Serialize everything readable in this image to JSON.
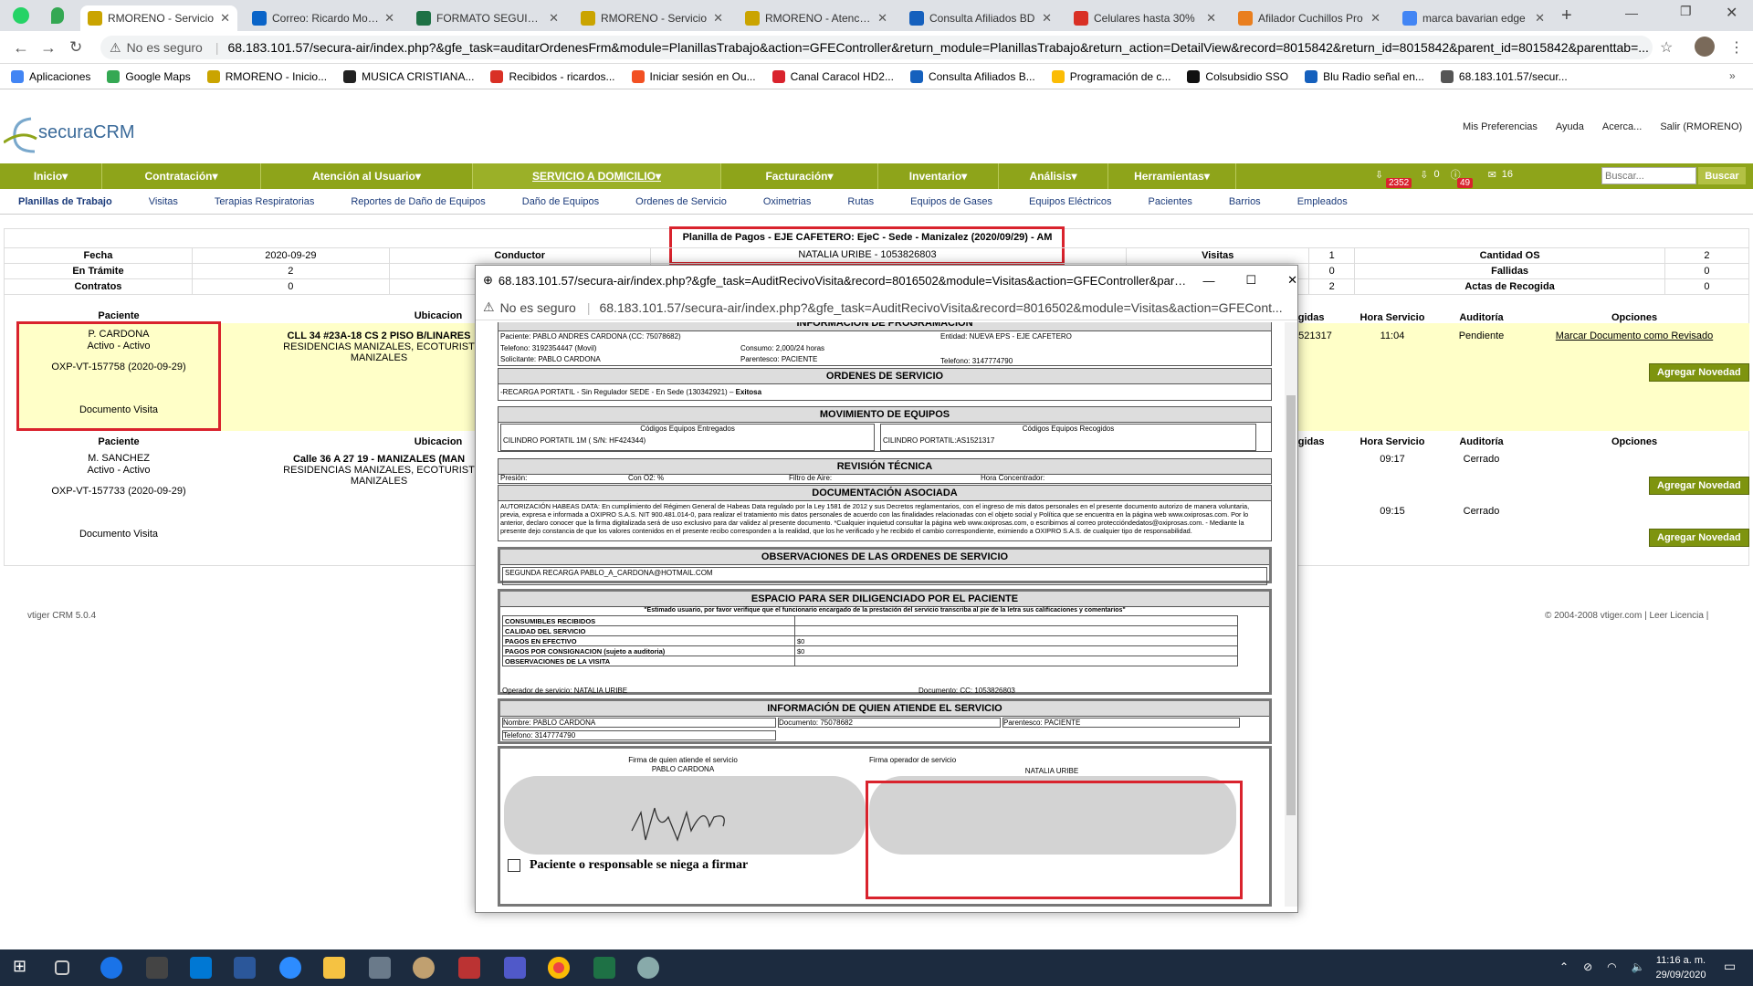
{
  "browser": {
    "tabs": [
      {
        "label": "RMORENO - Servicio",
        "active": true,
        "icon": "vtiger-icon",
        "color": "#caa400"
      },
      {
        "label": "Correo: Ricardo Moreno",
        "icon": "outlook-icon",
        "color": "#0a64c8"
      },
      {
        "label": "FORMATO SEGUIMIENTO",
        "icon": "excel-icon",
        "color": "#1e7145"
      },
      {
        "label": "RMORENO - Servicio",
        "icon": "vtiger-icon",
        "color": "#caa400"
      },
      {
        "label": "RMORENO - Atención",
        "icon": "vtiger-icon",
        "color": "#caa400"
      },
      {
        "label": "Consulta Afiliados BD",
        "icon": "triangle-icon",
        "color": "#1560bd"
      },
      {
        "label": "Celulares hasta 30%",
        "icon": "gmail-icon",
        "color": "#d93025"
      },
      {
        "label": "Afilador Cuchillos Pro",
        "icon": "product-icon",
        "color": "#e97e1e"
      },
      {
        "label": "marca bavarian edge",
        "icon": "google-icon",
        "color": "#4285f4"
      }
    ],
    "not_secure": "No es seguro",
    "url": "68.183.101.57/secura-air/index.php?&gfe_task=auditarOrdenesFrm&module=PlanillasTrabajo&action=GFEController&return_module=PlanillasTrabajo&return_action=DetailView&record=8015842&return_id=8015842&parent_id=8015842&parenttab=...",
    "bookmarks": [
      "Aplicaciones",
      "Google Maps",
      "RMORENO - Inicio...",
      "MUSICA CRISTIANA...",
      "Recibidos - ricardos...",
      "Iniciar sesión en Ou...",
      "Canal Caracol HD2...",
      "Consulta Afiliados B...",
      "Programación de c...",
      "Colsubsidio SSO",
      "Blu Radio señal en...",
      "68.183.101.57/secur..."
    ]
  },
  "app": {
    "logo": "securaCRM",
    "top_links": [
      "Mis Preferencias",
      "Ayuda",
      "Acerca...",
      "Salir (RMORENO)"
    ],
    "menu": [
      "Inicio",
      "Contratación",
      "Atención al Usuario",
      "SERVICIO A DOMICILIO",
      "Facturación",
      "Inventario",
      "Análisis",
      "Herramientas"
    ],
    "badges": {
      "a": "2352",
      "b": "0",
      "c": "49",
      "d": "16"
    },
    "search_placeholder": "Buscar...",
    "search_button": "Buscar",
    "submenu": [
      "Planillas de Trabajo",
      "Visitas",
      "Terapias Respiratorias",
      "Reportes de Daño de Equipos",
      "Daño de Equipos",
      "Ordenes de Servicio",
      "Oximetrias",
      "Rutas",
      "Equipos de Gases",
      "Equipos Eléctricos",
      "Pacientes",
      "Barrios",
      "Empleados"
    ]
  },
  "planilla": {
    "title": "Planilla de Pagos - EJE CAFETERO: EjeC - Sede - Manizalez (2020/09/29) - AM",
    "subtitle": "NATALIA URIBE - 1053826803",
    "fecha_label": "Fecha",
    "fecha": "2020-09-29",
    "conductor_label": "Conductor",
    "tramite_label": "En Trámite",
    "tramite": "2",
    "contratos_label": "Contratos",
    "contratos": "0",
    "visitas_label": "Visitas",
    "visitas": "1",
    "fallidas_label": "",
    "fallidas_val": "0",
    "row3_val": "2",
    "cant_os_label": "Cantidad OS",
    "cant_os": "2",
    "fallidas2_label": "Fallidas",
    "fallidas2": "0",
    "actas_label": "Actas de Recogida",
    "actas": "0",
    "col_paciente": "Paciente",
    "col_ubicacion": "Ubicacion",
    "col_recogidas": "ogidas",
    "col_hora": "Hora Servicio",
    "col_auditoria": "Auditoría",
    "col_opciones": "Opciones",
    "rows": [
      {
        "paciente": "P. CARDONA",
        "estado": "Activo - Activo",
        "codigo": "OXP-VT-157758 (2020-09-29)",
        "doc": "Documento Visita",
        "ubic1": "CLL 34 #23A-18 CS 2 PISO B/LINARES",
        "ubic2": "RESIDENCIAS MANIZALES, ECOTURIST",
        "ubic3": "MANIZALES",
        "recog": "1521317",
        "hora": "11:04",
        "audit": "Pendiente",
        "opcion": "Marcar Documento como Revisado",
        "novedad": "Agregar Novedad"
      },
      {
        "paciente": "M. SANCHEZ",
        "estado": "Activo - Activo",
        "codigo": "OXP-VT-157733 (2020-09-29)",
        "doc": "Documento Visita",
        "ubic1": "Calle 36 A 27 19 - MANIZALES (MAN",
        "ubic2": "RESIDENCIAS MANIZALES, ECOTURIST",
        "ubic3": "MANIZALES",
        "hora": "09:17",
        "audit": "Cerrado",
        "hora2": "09:15",
        "audit2": "Cerrado",
        "novedad": "Agregar Novedad",
        "novedad2": "Agregar Novedad"
      }
    ]
  },
  "footer": {
    "left": "vtiger CRM 5.0.4",
    "right": "© 2004-2008 vtiger.com | Leer Licencia |"
  },
  "popup": {
    "title": "68.183.101.57/secura-air/index.php?&gfe_task=AuditRecivoVisita&record=8016502&module=Visitas&action=GFEController&parenttab=...",
    "not_secure": "No es seguro",
    "url": "68.183.101.57/secura-air/index.php?&gfe_task=AuditRecivoVisita&record=8016502&module=Visitas&action=GFECont...",
    "prog_head": "INFORMACIÓN DE PROGRAMACIÓN",
    "paciente_line": "Paciente: PABLO ANDRES CARDONA (CC: 75078682)",
    "entidad": "Entidad: NUEVA EPS - EJE CAFETERO",
    "telefono": "Telefono: 3192354447 (Movil)",
    "consumo": "Consumo: 2,000/24 horas",
    "solicitante": "Solicitante: PABLO CARDONA",
    "parentesco": "Parentesco: PACIENTE",
    "telefono2": "Telefono: 3147774790",
    "ordenes_head": "ORDENES DE SERVICIO",
    "orden": "-RECARGA PORTATIL - Sin Regulador SEDE - En Sede (130342921)",
    "orden_estado": "Exitosa",
    "mov_head": "MOVIMIENTO DE EQUIPOS",
    "eq_ent_label": "Códigos Equipos Entregados",
    "eq_ent": "CILINDRO PORTATIL 1M ( S/N: HF424344)",
    "eq_rec_label": "Códigos Equipos Recogidos",
    "eq_rec": "CILINDRO PORTATIL:AS1521317",
    "rev_head": "REVISIÓN TÉCNICA",
    "presion": "Presión:",
    "con_o2": "Con O2: %",
    "filtro": "Filtro de Aire:",
    "hora_conc": "Hora Concentrador:",
    "doc_head": "DOCUMENTACIÓN ASOCIADA",
    "habeas": "AUTORIZACIÓN HABEAS DATA: En cumplimiento del Régimen General de Habeas Data regulado por la Ley 1581 de 2012 y sus Decretos reglamentarios, con el ingreso de mis datos personales en el presente documento autorizo de manera voluntaria, previa, expresa e informada a OXIPRO S.A.S. NIT 900.481.014-0, para realizar el tratamiento mis datos personales de acuerdo con las finalidades relacionadas con el objeto social y Política que se encuentra en la página web www.oxiprosas.com. Por lo anterior, declaro conocer que la firma digitalizada será de uso exclusivo para dar validez al presente documento. *Cualquier inquietud consultar la página web www.oxiprosas.com, o escribirnos al correo proteccióndedatos@oxiprosas.com. - Mediante la presente dejo constancia de que los valores contenidos en el presente recibo corresponden a la realidad, que los he verificado y he recibido el cambio correspondiente, eximiendo a OXIPRO S.A.S. de cualquier tipo de responsabilidad.",
    "obs_head": "OBSERVACIONES DE LAS ORDENES DE SERVICIO",
    "obs": "SEGUNDA RECARGA PABLO_A_CARDONA@HOTMAIL.COM",
    "esp_head": "ESPACIO PARA SER DILIGENCIADO POR EL PACIENTE",
    "esp_note": "\"Estimado usuario, por favor verifique que el funcionario encargado de la prestación del servicio transcriba al pie de la letra sus calificaciones y comentarios\"",
    "esp_rows": [
      [
        "CONSUMIBLES RECIBIDOS",
        ""
      ],
      [
        "CALIDAD DEL SERVICIO",
        ""
      ],
      [
        "PAGOS EN EFECTIVO",
        "$0"
      ],
      [
        "PAGOS POR CONSIGNACION (sujeto a auditoria)",
        "$0"
      ],
      [
        "OBSERVACIONES DE LA VISITA",
        ""
      ]
    ],
    "operador": "Operador de servicio: NATALIA URIBE",
    "documento": "Documento: CC: 1053826803",
    "quien_head": "INFORMACIÓN DE QUIEN ATIENDE EL SERVICIO",
    "nombre": "Nombre: PABLO CARDONA",
    "doc_quien": "Documento: 75078682",
    "par_quien": "Parentesco: PACIENTE",
    "tel_quien": "Telefono: 3147774790",
    "firma1_label": "Firma de quien atiende el servicio",
    "firma1_name": "PABLO CARDONA",
    "firma2_label": "Firma operador de servicio",
    "firma2_name": "NATALIA URIBE",
    "niega": "Paciente o responsable se niega a firmar"
  },
  "taskbar": {
    "time": "11:16 a. m.",
    "date": "29/09/2020"
  }
}
